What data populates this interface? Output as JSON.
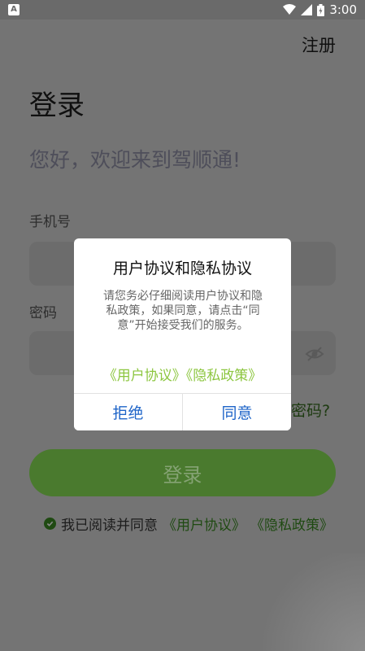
{
  "status_bar": {
    "notification_icon": "A",
    "time": "3:00"
  },
  "header": {
    "register_label": "注册"
  },
  "login": {
    "title": "登录",
    "welcome": "您好，欢迎来到驾顺通!",
    "phone_label": "手机号",
    "password_label": "密码",
    "forgot_partial": "密码?",
    "login_button": "登录",
    "agree_text": "我已阅读并同意",
    "user_agreement_link": "《用户协议》",
    "privacy_link": "《隐私政策》"
  },
  "dialog": {
    "title": "用户协议和隐私协议",
    "body": "请您务必仔细阅读用户协议和隐私政策，如果同意，请点击“同意”开始接受我们的服务。",
    "policy_links": "《用户协议》《隐私政策》",
    "reject_label": "拒绝",
    "agree_label": "同意"
  },
  "colors": {
    "brand_green": "#4a7a2e",
    "link_green": "#8cc63f",
    "dialog_button_blue": "#1e64c8"
  }
}
